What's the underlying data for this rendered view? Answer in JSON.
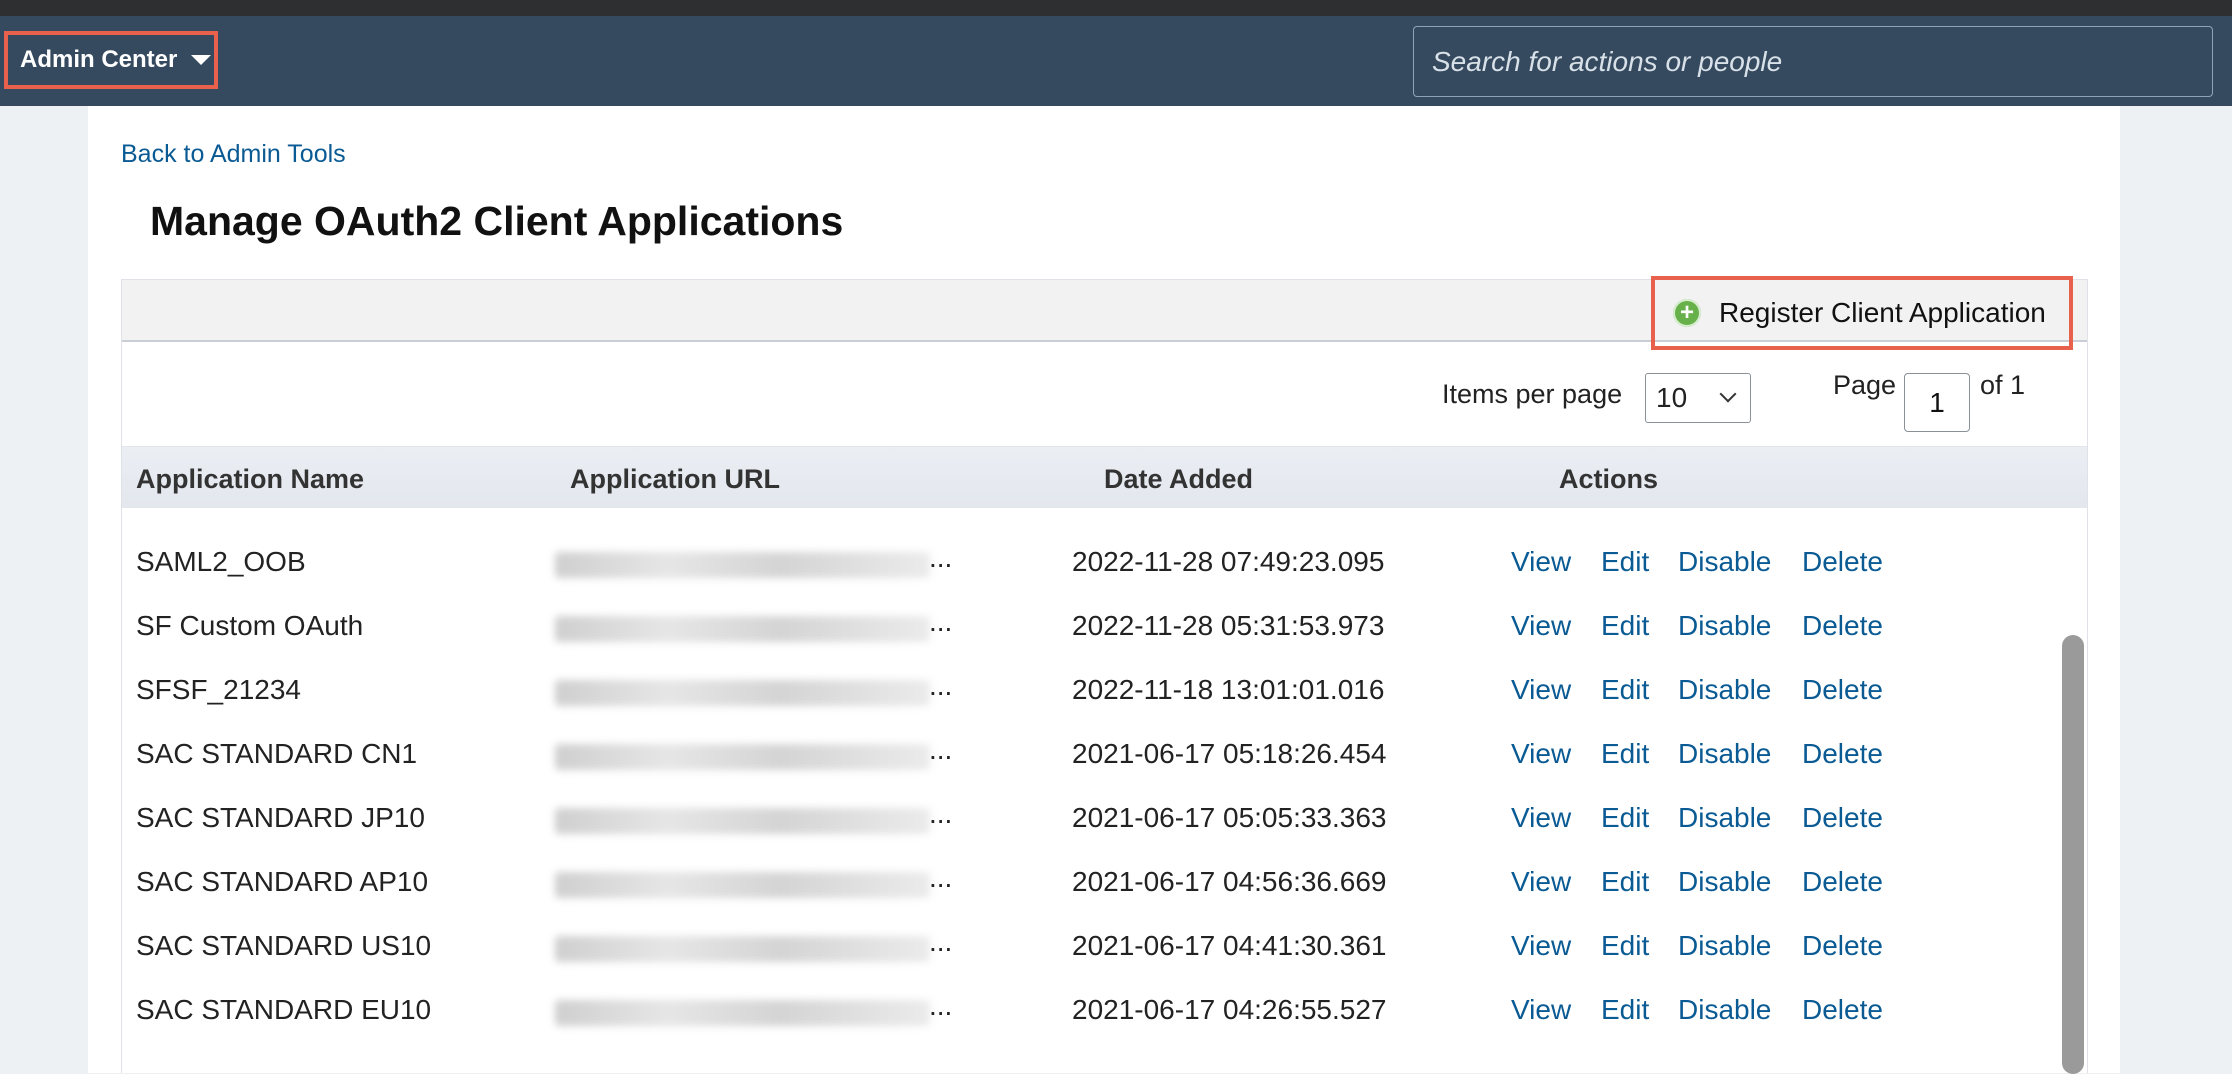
{
  "shell": {
    "admin_center_label": "Admin Center",
    "search_placeholder": "Search for actions or people"
  },
  "nav": {
    "back_link": "Back to Admin Tools"
  },
  "page": {
    "title": "Manage OAuth2 Client Applications"
  },
  "toolbar": {
    "register_label": "Register Client Application"
  },
  "pager": {
    "items_per_page_label": "Items per page",
    "items_per_page_value": "10",
    "page_label": "Page",
    "page_value": "1",
    "of_label": "of 1"
  },
  "table": {
    "headers": [
      "Application Name",
      "Application URL",
      "Date Added",
      "Actions"
    ],
    "action_labels": [
      "View",
      "Edit",
      "Disable",
      "Delete"
    ],
    "url_suffix": "...",
    "rows": [
      {
        "name": "SAML2_OOB",
        "date": "2022-11-28 07:49:23.095"
      },
      {
        "name": "SF Custom OAuth",
        "date": "2022-11-28 05:31:53.973"
      },
      {
        "name": "SFSF_21234",
        "date": "2022-11-18 13:01:01.016"
      },
      {
        "name": "SAC STANDARD CN1",
        "date": "2021-06-17 05:18:26.454"
      },
      {
        "name": "SAC STANDARD JP10",
        "date": "2021-06-17 05:05:33.363"
      },
      {
        "name": "SAC STANDARD AP10",
        "date": "2021-06-17 04:56:36.669"
      },
      {
        "name": "SAC STANDARD US10",
        "date": "2021-06-17 04:41:30.361"
      },
      {
        "name": "SAC STANDARD EU10",
        "date": "2021-06-17 04:26:55.527"
      }
    ]
  }
}
